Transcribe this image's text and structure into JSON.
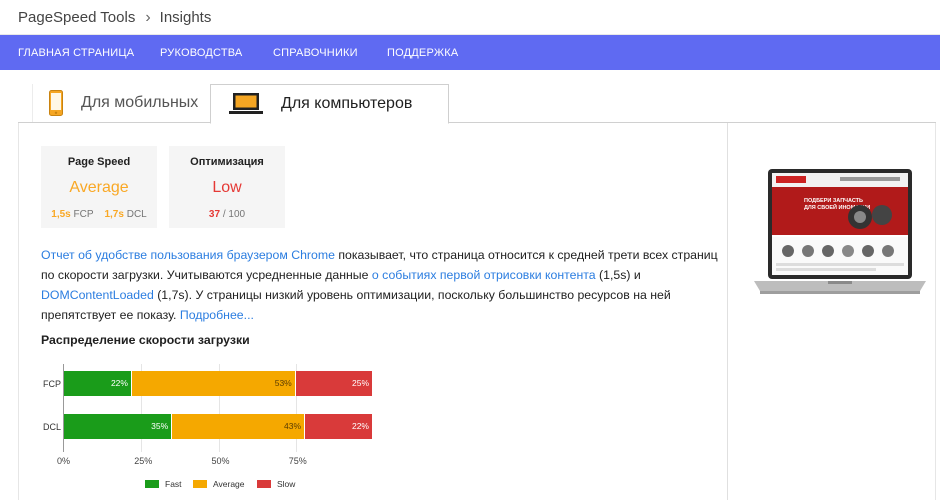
{
  "breadcrumb": {
    "root": "PageSpeed Tools",
    "separator": "›",
    "current": "Insights"
  },
  "nav": {
    "items": [
      "ГЛАВНАЯ СТРАНИЦА",
      "РУКОВОДСТВА",
      "СПРАВОЧНИКИ",
      "ПОДДЕРЖКА"
    ]
  },
  "tabs": {
    "mobile": "Для мобильных",
    "desktop": "Для компьютеров"
  },
  "scores": {
    "speed": {
      "title": "Page Speed",
      "value": "Average",
      "fcp_value": "1,5s",
      "fcp_label": "FCP",
      "dcl_value": "1,7s",
      "dcl_label": "DCL",
      "color": "#f9a825"
    },
    "optimization": {
      "title": "Оптимизация",
      "value": "Low",
      "score": "37",
      "score_suffix": "/ 100",
      "color": "#e53935"
    }
  },
  "description": {
    "link1": "Отчет об удобстве пользования браузером Chrome",
    "text1": " показывает, что страница относится к средней трети всех страниц по скорости загрузки. Учитываются усредненные данные ",
    "link2": "о событиях первой отрисовки контента",
    "text2": " (1,5s) и ",
    "link3": "DOMContentLoaded",
    "text3": " (1,7s). У страницы низкий уровень оптимизации, поскольку большинство ресурсов на ней препятствует ее показу. ",
    "link4": "Подробнее..."
  },
  "distribution_title": "Распределение скорости загрузки",
  "chart_data": {
    "type": "bar",
    "stacked": true,
    "orientation": "horizontal",
    "categories": [
      "FCP",
      "DCL"
    ],
    "series": [
      {
        "name": "Fast",
        "values": [
          22,
          35
        ],
        "color": "#1a9c1a"
      },
      {
        "name": "Average",
        "values": [
          53,
          43
        ],
        "color": "#f5a800"
      },
      {
        "name": "Slow",
        "values": [
          25,
          22
        ],
        "color": "#d93a3a"
      }
    ],
    "value_labels": [
      [
        "22%",
        "53%",
        "25%"
      ],
      [
        "35%",
        "43%",
        "22%"
      ]
    ],
    "x_ticks": [
      "0%",
      "25%",
      "50%",
      "75%"
    ],
    "xlim": [
      0,
      100
    ]
  },
  "preview": {
    "laptop_screen_text_1": "ПОДБЕРИ ЗАПЧАСТЬ",
    "laptop_screen_text_2": "ДЛЯ СВОЕЙ ИНОМАРКИ"
  }
}
